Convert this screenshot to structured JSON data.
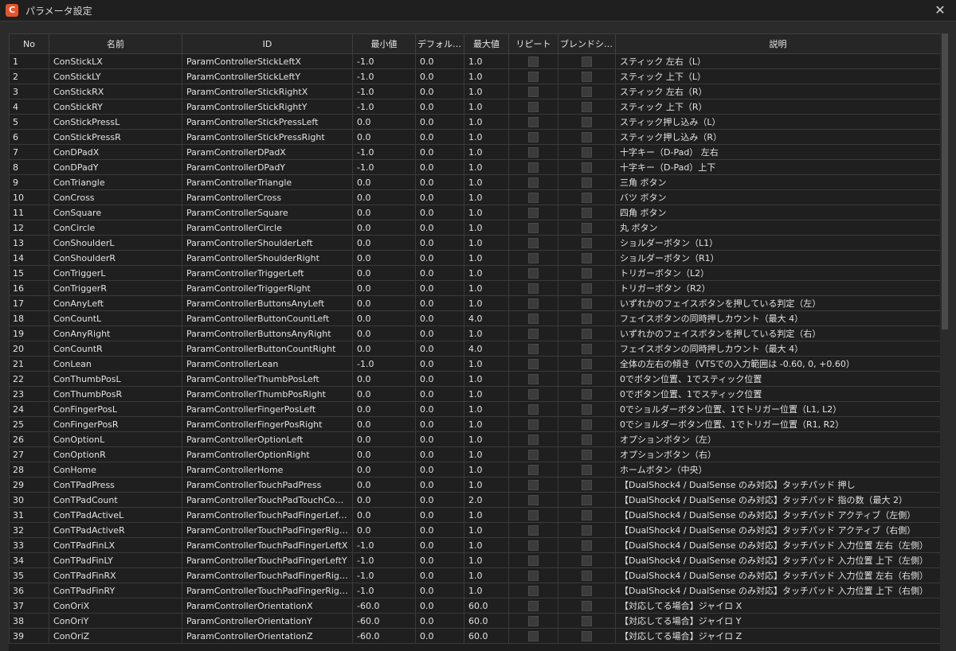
{
  "window": {
    "title": "パラメータ設定",
    "app_icon_glyph": "C",
    "close_glyph": "✕"
  },
  "columns": [
    "No",
    "名前",
    "ID",
    "最小値",
    "デフォルト値",
    "最大値",
    "リピート",
    "ブレンドシェ...",
    "説明"
  ],
  "rows": [
    [
      "1",
      "ConStickLX",
      "ParamControllerStickLeftX",
      "-1.0",
      "0.0",
      "1.0",
      "スティック 左右（L）"
    ],
    [
      "2",
      "ConStickLY",
      "ParamControllerStickLeftY",
      "-1.0",
      "0.0",
      "1.0",
      "スティック 上下（L）"
    ],
    [
      "3",
      "ConStickRX",
      "ParamControllerStickRightX",
      "-1.0",
      "0.0",
      "1.0",
      "スティック 左右（R）"
    ],
    [
      "4",
      "ConStickRY",
      "ParamControllerStickRightY",
      "-1.0",
      "0.0",
      "1.0",
      "スティック 上下（R）"
    ],
    [
      "5",
      "ConStickPressL",
      "ParamControllerStickPressLeft",
      "0.0",
      "0.0",
      "1.0",
      "スティック押し込み（L）"
    ],
    [
      "6",
      "ConStickPressR",
      "ParamControllerStickPressRight",
      "0.0",
      "0.0",
      "1.0",
      "スティック押し込み（R）"
    ],
    [
      "7",
      "ConDPadX",
      "ParamControllerDPadX",
      "-1.0",
      "0.0",
      "1.0",
      "十字キー（D-Pad） 左右"
    ],
    [
      "8",
      "ConDPadY",
      "ParamControllerDPadY",
      "-1.0",
      "0.0",
      "1.0",
      "十字キー（D-Pad）上下"
    ],
    [
      "9",
      "ConTriangle",
      "ParamControllerTriangle",
      "0.0",
      "0.0",
      "1.0",
      "三角 ボタン"
    ],
    [
      "10",
      "ConCross",
      "ParamControllerCross",
      "0.0",
      "0.0",
      "1.0",
      "バツ ボタン"
    ],
    [
      "11",
      "ConSquare",
      "ParamControllerSquare",
      "0.0",
      "0.0",
      "1.0",
      "四角 ボタン"
    ],
    [
      "12",
      "ConCircle",
      "ParamControllerCircle",
      "0.0",
      "0.0",
      "1.0",
      "丸 ボタン"
    ],
    [
      "13",
      "ConShoulderL",
      "ParamControllerShoulderLeft",
      "0.0",
      "0.0",
      "1.0",
      "ショルダーボタン（L1）"
    ],
    [
      "14",
      "ConShoulderR",
      "ParamControllerShoulderRight",
      "0.0",
      "0.0",
      "1.0",
      "ショルダーボタン（R1）"
    ],
    [
      "15",
      "ConTriggerL",
      "ParamControllerTriggerLeft",
      "0.0",
      "0.0",
      "1.0",
      "トリガーボタン（L2）"
    ],
    [
      "16",
      "ConTriggerR",
      "ParamControllerTriggerRight",
      "0.0",
      "0.0",
      "1.0",
      "トリガーボタン（R2）"
    ],
    [
      "17",
      "ConAnyLeft",
      "ParamControllerButtonsAnyLeft",
      "0.0",
      "0.0",
      "1.0",
      "いずれかのフェイスボタンを押している判定（左）"
    ],
    [
      "18",
      "ConCountL",
      "ParamControllerButtonCountLeft",
      "0.0",
      "0.0",
      "4.0",
      "フェイスボタンの同時押しカウント（最大 4）"
    ],
    [
      "19",
      "ConAnyRight",
      "ParamControllerButtonsAnyRight",
      "0.0",
      "0.0",
      "1.0",
      "いずれかのフェイスボタンを押している判定（右）"
    ],
    [
      "20",
      "ConCountR",
      "ParamControllerButtonCountRight",
      "0.0",
      "0.0",
      "4.0",
      "フェイスボタンの同時押しカウント（最大 4）"
    ],
    [
      "21",
      "ConLean",
      "ParamControllerLean",
      "-1.0",
      "0.0",
      "1.0",
      "全体の左右の傾き（VTSでの入力範囲は -0.60, 0, +0.60）"
    ],
    [
      "22",
      "ConThumbPosL",
      "ParamControllerThumbPosLeft",
      "0.0",
      "0.0",
      "1.0",
      "0でボタン位置、1でスティック位置"
    ],
    [
      "23",
      "ConThumbPosR",
      "ParamControllerThumbPosRight",
      "0.0",
      "0.0",
      "1.0",
      "0でボタン位置、1でスティック位置"
    ],
    [
      "24",
      "ConFingerPosL",
      "ParamControllerFingerPosLeft",
      "0.0",
      "0.0",
      "1.0",
      "0でショルダーボタン位置、1でトリガー位置（L1, L2）"
    ],
    [
      "25",
      "ConFingerPosR",
      "ParamControllerFingerPosRight",
      "0.0",
      "0.0",
      "1.0",
      "0でショルダーボタン位置、1でトリガー位置（R1, R2）"
    ],
    [
      "26",
      "ConOptionL",
      "ParamControllerOptionLeft",
      "0.0",
      "0.0",
      "1.0",
      "オプションボタン（左）"
    ],
    [
      "27",
      "ConOptionR",
      "ParamControllerOptionRight",
      "0.0",
      "0.0",
      "1.0",
      "オプションボタン（右）"
    ],
    [
      "28",
      "ConHome",
      "ParamControllerHome",
      "0.0",
      "0.0",
      "1.0",
      "ホームボタン（中央）"
    ],
    [
      "29",
      "ConTPadPress",
      "ParamControllerTouchPadPress",
      "0.0",
      "0.0",
      "1.0",
      "【DualShock4 / DualSense のみ対応】タッチパッド 押し"
    ],
    [
      "30",
      "ConTPadCount",
      "ParamControllerTouchPadTouchCount",
      "0.0",
      "0.0",
      "2.0",
      "【DualShock4 / DualSense のみ対応】タッチパッド 指の数（最大 2）"
    ],
    [
      "31",
      "ConTPadActiveL",
      "ParamControllerTouchPadFingerLeftA...",
      "0.0",
      "0.0",
      "1.0",
      "【DualShock4 / DualSense のみ対応】タッチパッド アクティブ（左側）"
    ],
    [
      "32",
      "ConTPadActiveR",
      "ParamControllerTouchPadFingerRight...",
      "0.0",
      "0.0",
      "1.0",
      "【DualShock4 / DualSense のみ対応】タッチパッド アクティブ（右側）"
    ],
    [
      "33",
      "ConTPadFinLX",
      "ParamControllerTouchPadFingerLeftX",
      "-1.0",
      "0.0",
      "1.0",
      "【DualShock4 / DualSense のみ対応】タッチパッド 入力位置 左右（左側）"
    ],
    [
      "34",
      "ConTPadFinLY",
      "ParamControllerTouchPadFingerLeftY",
      "-1.0",
      "0.0",
      "1.0",
      "【DualShock4 / DualSense のみ対応】タッチパッド 入力位置 上下（左側）"
    ],
    [
      "35",
      "ConTPadFinRX",
      "ParamControllerTouchPadFingerRightX",
      "-1.0",
      "0.0",
      "1.0",
      "【DualShock4 / DualSense のみ対応】タッチパッド 入力位置 左右（右側）"
    ],
    [
      "36",
      "ConTPadFinRY",
      "ParamControllerTouchPadFingerRightY",
      "-1.0",
      "0.0",
      "1.0",
      "【DualShock4 / DualSense のみ対応】タッチパッド 入力位置 上下（右側）"
    ],
    [
      "37",
      "ConOriX",
      "ParamControllerOrientationX",
      "-60.0",
      "0.0",
      "60.0",
      "【対応してる場合】ジャイロ X"
    ],
    [
      "38",
      "ConOriY",
      "ParamControllerOrientationY",
      "-60.0",
      "0.0",
      "60.0",
      "【対応してる場合】ジャイロ Y"
    ],
    [
      "39",
      "ConOriZ",
      "ParamControllerOrientationZ",
      "-60.0",
      "0.0",
      "60.0",
      "【対応してる場合】ジャイロ Z"
    ]
  ]
}
